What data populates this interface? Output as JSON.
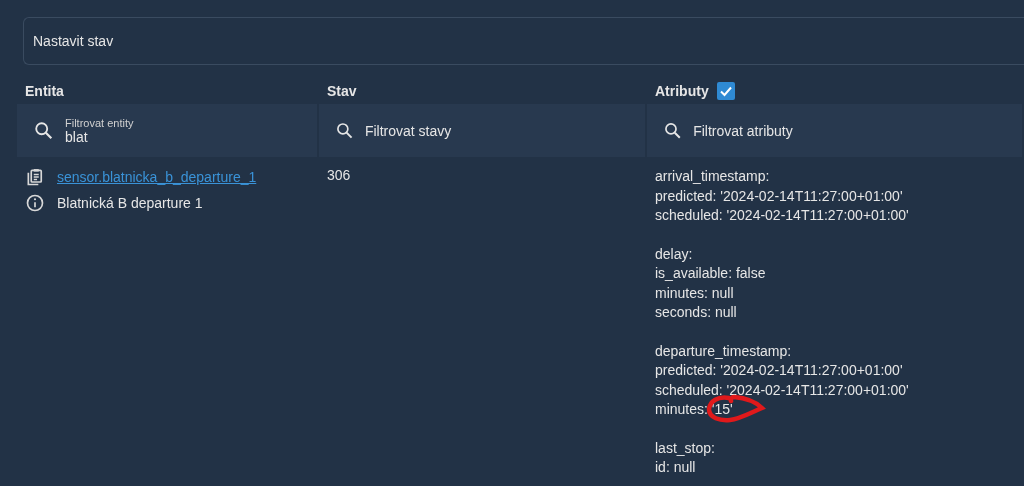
{
  "state_field": {
    "placeholder": "Nastavit stav"
  },
  "columns": [
    {
      "label": "Entita"
    },
    {
      "label": "Stav"
    },
    {
      "label": "Atributy",
      "checked": true
    }
  ],
  "filters": [
    {
      "label": "Filtrovat entity",
      "value": "blat"
    },
    {
      "placeholder": "Filtrovat stavy"
    },
    {
      "placeholder": "Filtrovat atributy"
    }
  ],
  "rows": [
    {
      "entity_id": "sensor.blatnicka_b_departure_1",
      "friendly_name": "Blatnická B departure 1",
      "state": "306",
      "attribute_groups": [
        {
          "lines": [
            "arrival_timestamp:",
            "predicted: '2024-02-14T11:27:00+01:00'",
            "scheduled: '2024-02-14T11:27:00+01:00'"
          ]
        },
        {
          "lines": [
            "delay:",
            "is_available: false",
            "minutes: null",
            "seconds: null"
          ]
        },
        {
          "lines": [
            "departure_timestamp:",
            "predicted: '2024-02-14T11:27:00+01:00'",
            "scheduled: '2024-02-14T11:27:00+01:00'",
            "minutes: '15'"
          ]
        },
        {
          "lines": [
            "last_stop:",
            "id: null"
          ]
        }
      ]
    }
  ],
  "annotation": {
    "kind": "circle",
    "color": "#e0191b"
  }
}
